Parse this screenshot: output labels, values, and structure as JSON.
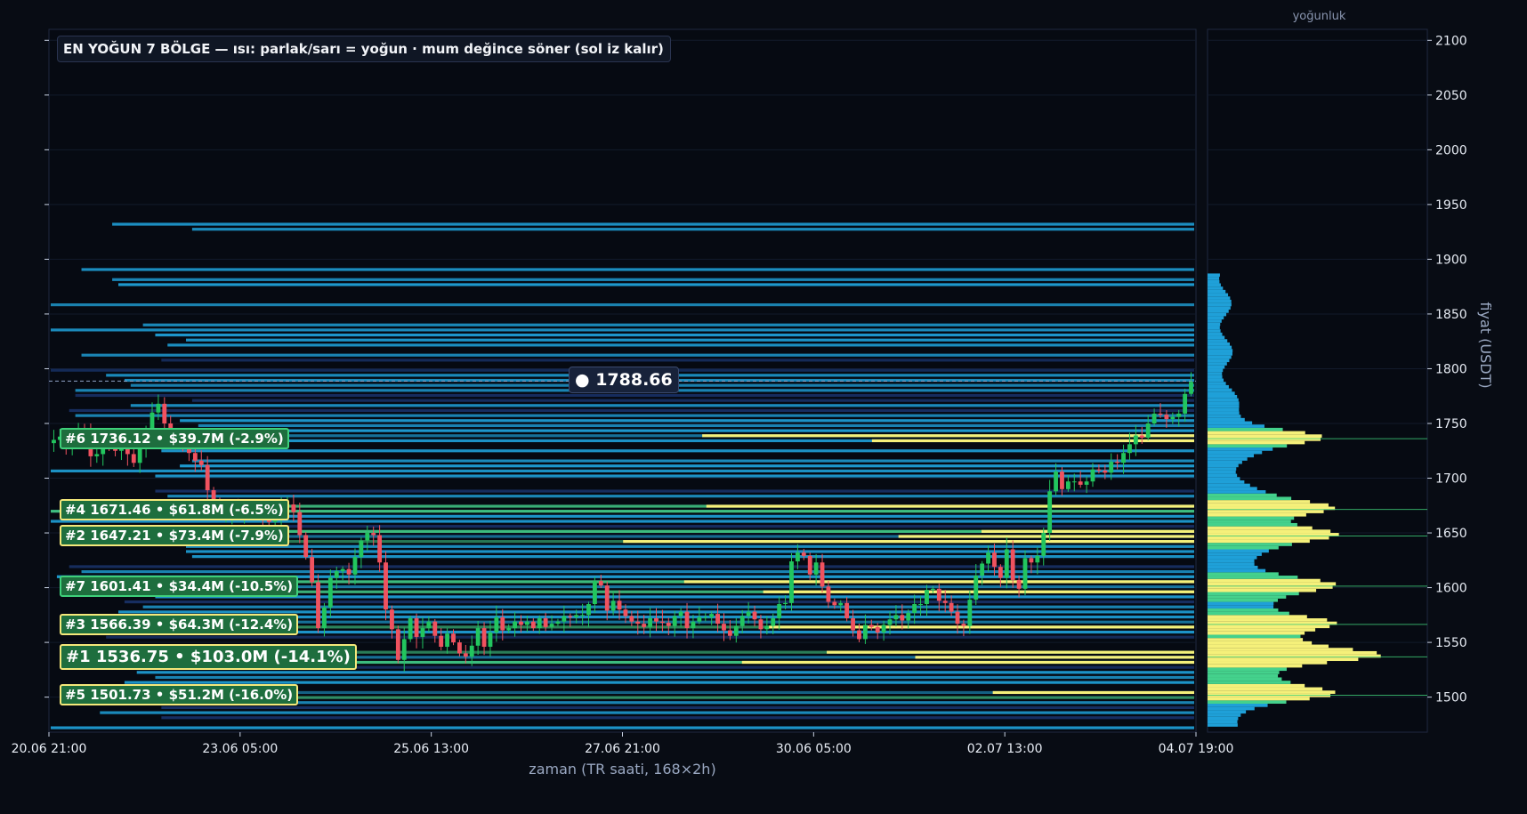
{
  "header": {
    "title": "EN YOĞUN 7 BÖLGE — ısı: parlak/sarı = yoğun · mum değince söner (sol iz kalır)",
    "side_panel_title": "yoğunluk"
  },
  "current_price_label": "● 1788.66",
  "zones": [
    {
      "rank": "#6",
      "text": "#6  1736.12  •  $39.7M  (-2.9%)",
      "price": 1736.12,
      "border": "green"
    },
    {
      "rank": "#4",
      "text": "#4  1671.46  •  $61.8M  (-6.5%)",
      "price": 1671.46,
      "border": "yellow"
    },
    {
      "rank": "#2",
      "text": "#2  1647.21  •  $73.4M  (-7.9%)",
      "price": 1647.21,
      "border": "yellow"
    },
    {
      "rank": "#7",
      "text": "#7  1601.41  •  $34.4M  (-10.5%)",
      "price": 1601.41,
      "border": "green"
    },
    {
      "rank": "#3",
      "text": "#3  1566.39  •  $64.3M  (-12.4%)",
      "price": 1566.39,
      "border": "yellow"
    },
    {
      "rank": "#1",
      "text": "#1  1536.75  •  $103.0M  (-14.1%)",
      "price": 1536.75,
      "border": "yellow"
    },
    {
      "rank": "#5",
      "text": "#5  1501.73  •  $51.2M  (-16.0%)",
      "price": 1501.73,
      "border": "yellow"
    }
  ],
  "chart_data": {
    "type": "candlestick-heatmap",
    "xlabel": "zaman (TR saati, 168×2h)",
    "ylabel": "fiyat (USDT)",
    "ylim": [
      1468,
      2110
    ],
    "y_ticks": [
      1500,
      1550,
      1600,
      1650,
      1700,
      1750,
      1800,
      1850,
      1900,
      1950,
      2000,
      2050,
      2100
    ],
    "x_ticks": [
      "20.06 21:00",
      "23.06 05:00",
      "25.06 13:00",
      "27.06 21:00",
      "30.06 05:00",
      "02.07 13:00",
      "04.07 19:00"
    ],
    "current_price": 1788.66,
    "colors": {
      "up": "#22c55e",
      "down": "#f0525f",
      "heat_low": "#1d3a7a",
      "heat_mid": "#1fa0d8",
      "heat_high": "#44d18c",
      "heat_max": "#f5f07a"
    },
    "closes": [
      1735,
      1738,
      1728,
      1735,
      1742,
      1740,
      1720,
      1722,
      1731,
      1730,
      1725,
      1728,
      1722,
      1714,
      1729,
      1745,
      1760,
      1768,
      1750,
      1738,
      1737,
      1730,
      1723,
      1716,
      1712,
      1689,
      1672,
      1665,
      1666,
      1671,
      1669,
      1672,
      1670,
      1672,
      1666,
      1660,
      1668,
      1674,
      1676,
      1669,
      1648,
      1628,
      1605,
      1563,
      1582,
      1609,
      1615,
      1617,
      1612,
      1628,
      1643,
      1650,
      1648,
      1623,
      1580,
      1562,
      1534,
      1553,
      1572,
      1555,
      1563,
      1569,
      1556,
      1546,
      1558,
      1550,
      1540,
      1537,
      1547,
      1563,
      1546,
      1559,
      1573,
      1561,
      1563,
      1569,
      1566,
      1569,
      1563,
      1572,
      1564,
      1567,
      1569,
      1574,
      1573,
      1575,
      1575,
      1585,
      1606,
      1602,
      1579,
      1588,
      1580,
      1574,
      1569,
      1567,
      1564,
      1572,
      1569,
      1568,
      1565,
      1574,
      1578,
      1563,
      1569,
      1573,
      1573,
      1576,
      1567,
      1561,
      1556,
      1565,
      1574,
      1578,
      1571,
      1562,
      1565,
      1572,
      1585,
      1586,
      1624,
      1632,
      1629,
      1612,
      1623,
      1601,
      1587,
      1584,
      1586,
      1572,
      1561,
      1553,
      1566,
      1564,
      1559,
      1566,
      1571,
      1575,
      1570,
      1577,
      1585,
      1585,
      1598,
      1599,
      1588,
      1586,
      1578,
      1567,
      1565,
      1589,
      1611,
      1622,
      1632,
      1619,
      1609,
      1635,
      1607,
      1599,
      1627,
      1623,
      1629,
      1650,
      1688,
      1706,
      1690,
      1697,
      1697,
      1694,
      1697,
      1708,
      1707,
      1705,
      1715,
      1714,
      1723,
      1731,
      1739,
      1737,
      1750,
      1759,
      1758,
      1754,
      1756,
      1759,
      1777,
      1788
    ]
  }
}
